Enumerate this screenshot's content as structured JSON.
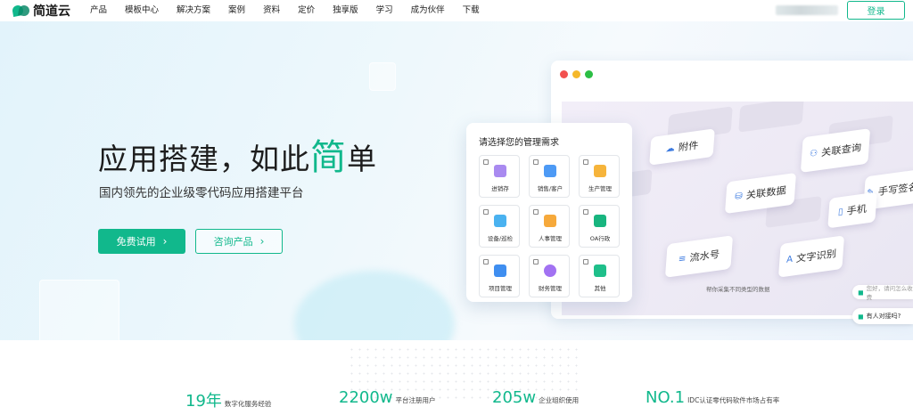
{
  "nav": {
    "brand": "简道云",
    "items": [
      "产品",
      "模板中心",
      "解决方案",
      "案例",
      "资料",
      "定价",
      "独享版",
      "学习",
      "成为伙伴",
      "下载"
    ],
    "login_label": "登录"
  },
  "hero": {
    "title_prefix": "应用搭建，如此",
    "title_highlight": "简",
    "title_suffix": "单",
    "subtitle": "国内领先的企业级零代码应用搭建平台",
    "primary_button": "免费试用",
    "secondary_button": "咨询产品"
  },
  "screen": {
    "tiles": [
      "附件",
      "关联查询",
      "关联数据",
      "手写签名",
      "手机",
      "流水号",
      "文字识别"
    ],
    "caption": "帮你采集不同类型的数据"
  },
  "card": {
    "title": "请选择您的管理需求",
    "options": [
      "进销存",
      "销售/客户",
      "生产管理",
      "设备/巡检",
      "人事管理",
      "OA行政",
      "项目管理",
      "财务管理",
      "其他"
    ]
  },
  "chat": {
    "hint": "您好，请问怎么收费",
    "human": "有人对接吗?"
  },
  "stats": [
    {
      "value": "19年",
      "label": "数字化服务经验"
    },
    {
      "value": "2200w",
      "label": "平台注册用户"
    },
    {
      "value": "205w",
      "label": "企业组织使用"
    },
    {
      "value": "NO.1",
      "label": "IDC认证零代码软件市场占有率"
    }
  ],
  "colors": {
    "accent": "#11b88c",
    "link_blue": "#3d7be0"
  }
}
